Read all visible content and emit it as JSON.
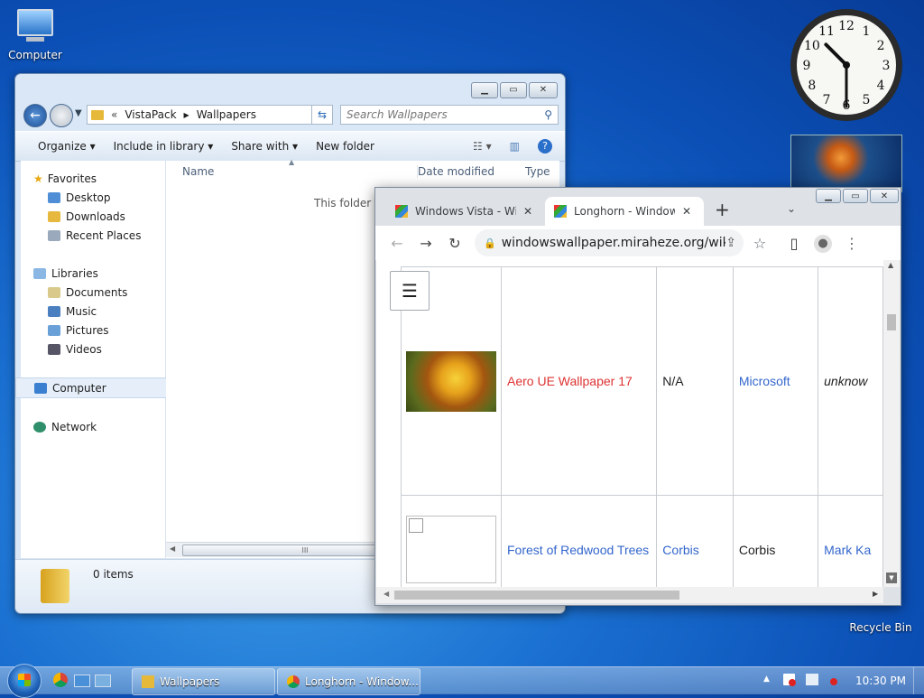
{
  "desktop": {
    "computer_icon_label": "Computer",
    "recycle_bin_label": "Recycle Bin",
    "clock": {
      "hour": 10,
      "minute": 30,
      "numerals": [
        "12",
        "1",
        "2",
        "3",
        "4",
        "5",
        "6",
        "7",
        "8",
        "9",
        "10",
        "11"
      ]
    }
  },
  "explorer": {
    "breadcrumb": [
      "VistaPack",
      "Wallpapers"
    ],
    "breadcrumb_prefix": "«",
    "search_placeholder": "Search Wallpapers",
    "commands": [
      "Organize",
      "Include in library",
      "Share with",
      "New folder"
    ],
    "nav": {
      "favorites": {
        "label": "Favorites",
        "items": [
          "Desktop",
          "Downloads",
          "Recent Places"
        ]
      },
      "libraries": {
        "label": "Libraries",
        "items": [
          "Documents",
          "Music",
          "Pictures",
          "Videos"
        ]
      },
      "computer": "Computer",
      "network": "Network"
    },
    "columns": [
      "Name",
      "Date modified",
      "Type"
    ],
    "empty_message": "This folder is",
    "status": "0 items",
    "scroll_grip": "III"
  },
  "browser": {
    "tabs": [
      {
        "title": "Windows Vista - Wir",
        "active": false
      },
      {
        "title": "Longhorn - Windows",
        "active": true
      }
    ],
    "new_tab": "+",
    "url": "windowswallpaper.miraheze.org/wiki/Lo...",
    "rows": [
      {
        "title": "Aero UE Wallpaper 17",
        "col3": "N/A",
        "col4": "Microsoft",
        "col5": "unknow"
      },
      {
        "title": "Forest of Redwood Trees",
        "col3": "Corbis",
        "col4": "Corbis",
        "col5": "Mark Ka"
      }
    ]
  },
  "taskbar": {
    "items": [
      "Wallpapers",
      "Longhorn - Window..."
    ],
    "time": "10:30 PM"
  }
}
